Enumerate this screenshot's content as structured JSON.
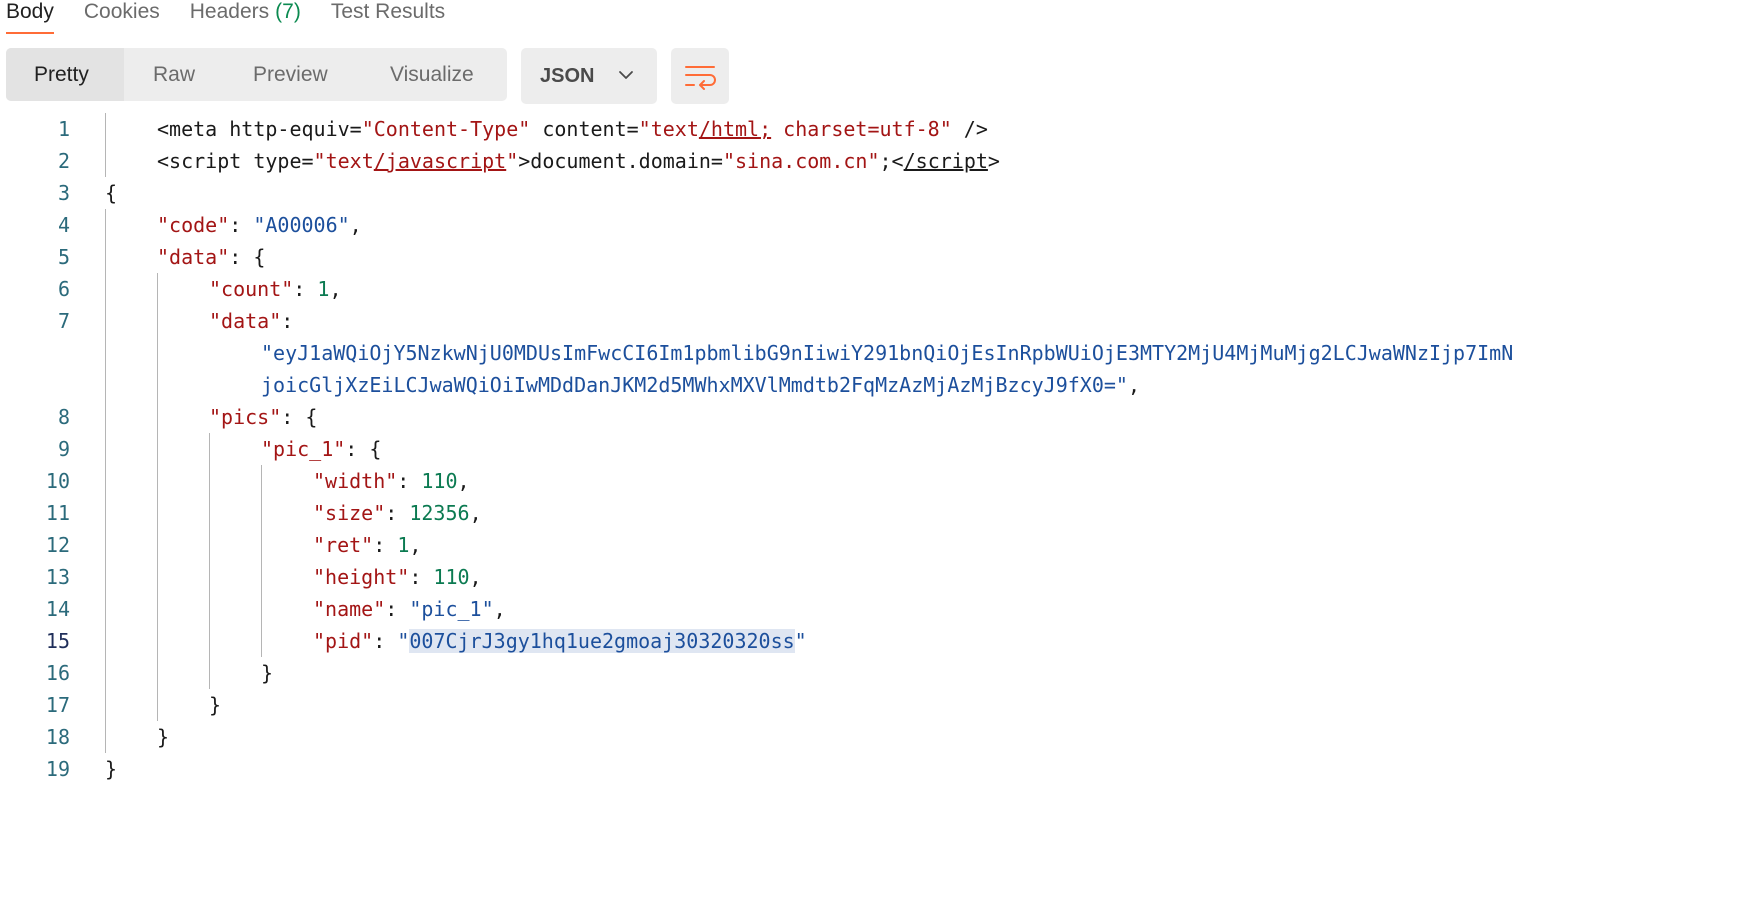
{
  "tabs": [
    {
      "label": "Body"
    },
    {
      "label": "Cookies"
    },
    {
      "label": "Headers",
      "count": "(7)"
    },
    {
      "label": "Test Results"
    }
  ],
  "view_modes": [
    "Pretty",
    "Raw",
    "Preview",
    "Visualize"
  ],
  "active_view_mode": "Pretty",
  "format": {
    "label": "JSON",
    "icon": "chevron-down-icon"
  },
  "wrap_button": {
    "icon": "wrap-lines-icon"
  },
  "colors": {
    "accent": "#ff6c37",
    "headers_count": "#0b8a50"
  },
  "editor": {
    "line_numbers": [
      "1",
      "2",
      "3",
      "4",
      "5",
      "6",
      "7",
      "8",
      "9",
      "10",
      "11",
      "12",
      "13",
      "14",
      "15",
      "16",
      "17",
      "18",
      "19"
    ],
    "current_line": "15",
    "lines": {
      "l1": {
        "open": "<meta http-equiv=",
        "v1": "\"Content-Type\"",
        "mid": " content=",
        "v2a": "\"text",
        "v2b": "/html;",
        "v2c": " charset=utf-8\"",
        "close": " />"
      },
      "l2": {
        "open": "<script type=",
        "v1a": "\"text",
        "v1b": "/javascript",
        "v1c": "\"",
        "mid": ">document.domain=",
        "v2": "\"sina.com.cn\"",
        "semi": ";<",
        "endtag": "/script",
        "gt": ">"
      },
      "l3": "{",
      "l4": {
        "key": "\"code\"",
        "sep": ": ",
        "val": "\"A00006\"",
        "end": ","
      },
      "l5": {
        "key": "\"data\"",
        "sep": ": {"
      },
      "l6": {
        "key": "\"count\"",
        "sep": ": ",
        "val": "1",
        "end": ","
      },
      "l7": {
        "key": "\"data\"",
        "sep": ":"
      },
      "l7_wrap1": "\"eyJ1aWQiOjY5NzkwNjU0MDUsImFwcCI6Im1pbmlibG9nIiwiY291bnQiOjEsInRpbWUiOjE3MTY2MjU4MjMuMjg2LCJwaWNzIjp7ImN",
      "l7_wrap2": "joicGljXzEiLCJwaWQiOiIwMDdDanJKM2d5MWhxMXVlMmdtb2FqMzAzMjAzMjBzcyJ9fX0=\"",
      "l7_wrap2_end": ",",
      "l8": {
        "key": "\"pics\"",
        "sep": ": {"
      },
      "l9": {
        "key": "\"pic_1\"",
        "sep": ": {"
      },
      "l10": {
        "key": "\"width\"",
        "sep": ": ",
        "val": "110",
        "end": ","
      },
      "l11": {
        "key": "\"size\"",
        "sep": ": ",
        "val": "12356",
        "end": ","
      },
      "l12": {
        "key": "\"ret\"",
        "sep": ": ",
        "val": "1",
        "end": ","
      },
      "l13": {
        "key": "\"height\"",
        "sep": ": ",
        "val": "110",
        "end": ","
      },
      "l14": {
        "key": "\"name\"",
        "sep": ": ",
        "val": "\"pic_1\"",
        "end": ","
      },
      "l15": {
        "key": "\"pid\"",
        "sep": ": ",
        "q1": "\"",
        "val": "007CjrJ3gy1hq1ue2gmoaj30320320ss",
        "q2": "\""
      },
      "l16": "}",
      "l17": "}",
      "l18": "}",
      "l19": "}"
    }
  }
}
